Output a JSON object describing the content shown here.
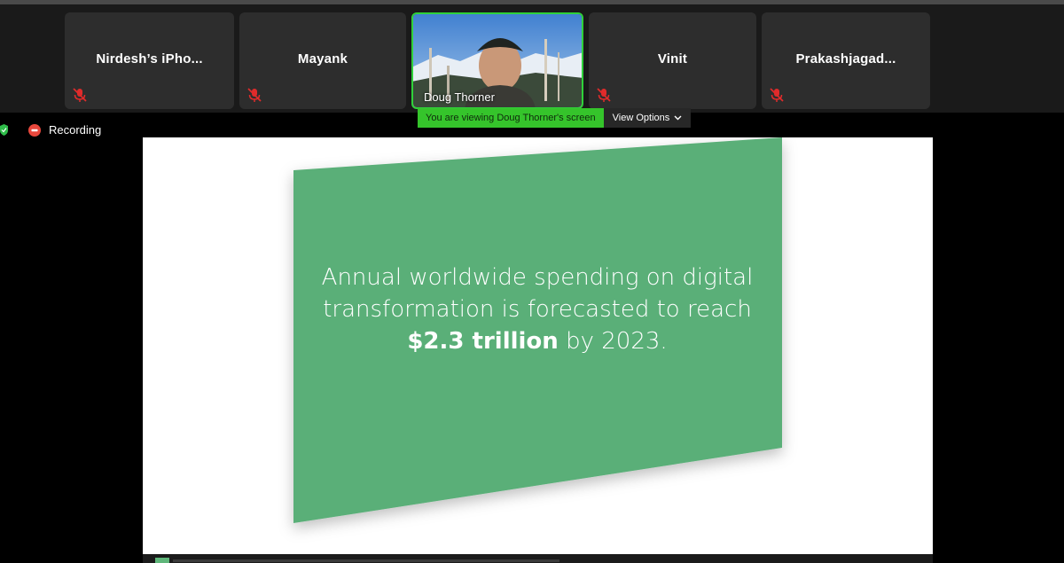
{
  "participants": [
    {
      "name": "Nirdesh’s iPho...",
      "muted": true
    },
    {
      "name": "Mayank",
      "muted": true
    },
    {
      "name": "Doug Thorner",
      "video": true,
      "active_speaker": true
    },
    {
      "name": "Vinit",
      "muted": true
    },
    {
      "name": "Prakashjagad...",
      "muted": true
    }
  ],
  "screen_share": {
    "viewing_message": "You are viewing Doug Thorner's screen",
    "view_options_label": "View Options"
  },
  "status": {
    "recording_label": "Recording"
  },
  "slide": {
    "text_before": "Annual worldwide spending on digital transformation is forecasted to reach ",
    "text_bold": "$2.3 trillion",
    "text_after": " by 2023.",
    "accent_color": "#5aaf78"
  },
  "colors": {
    "active_border": "#2fd13a",
    "viewing_bar": "#35c42b",
    "tile_bg": "#2d2d2d",
    "strip_bg": "#1a1a1a",
    "muted_icon": "#e02b2b",
    "recording_dot": "#e8473c",
    "shield": "#2fbd4a"
  },
  "icons": [
    "muted-mic-icon",
    "chevron-down-icon",
    "shield-check-icon",
    "recording-dot-icon"
  ]
}
